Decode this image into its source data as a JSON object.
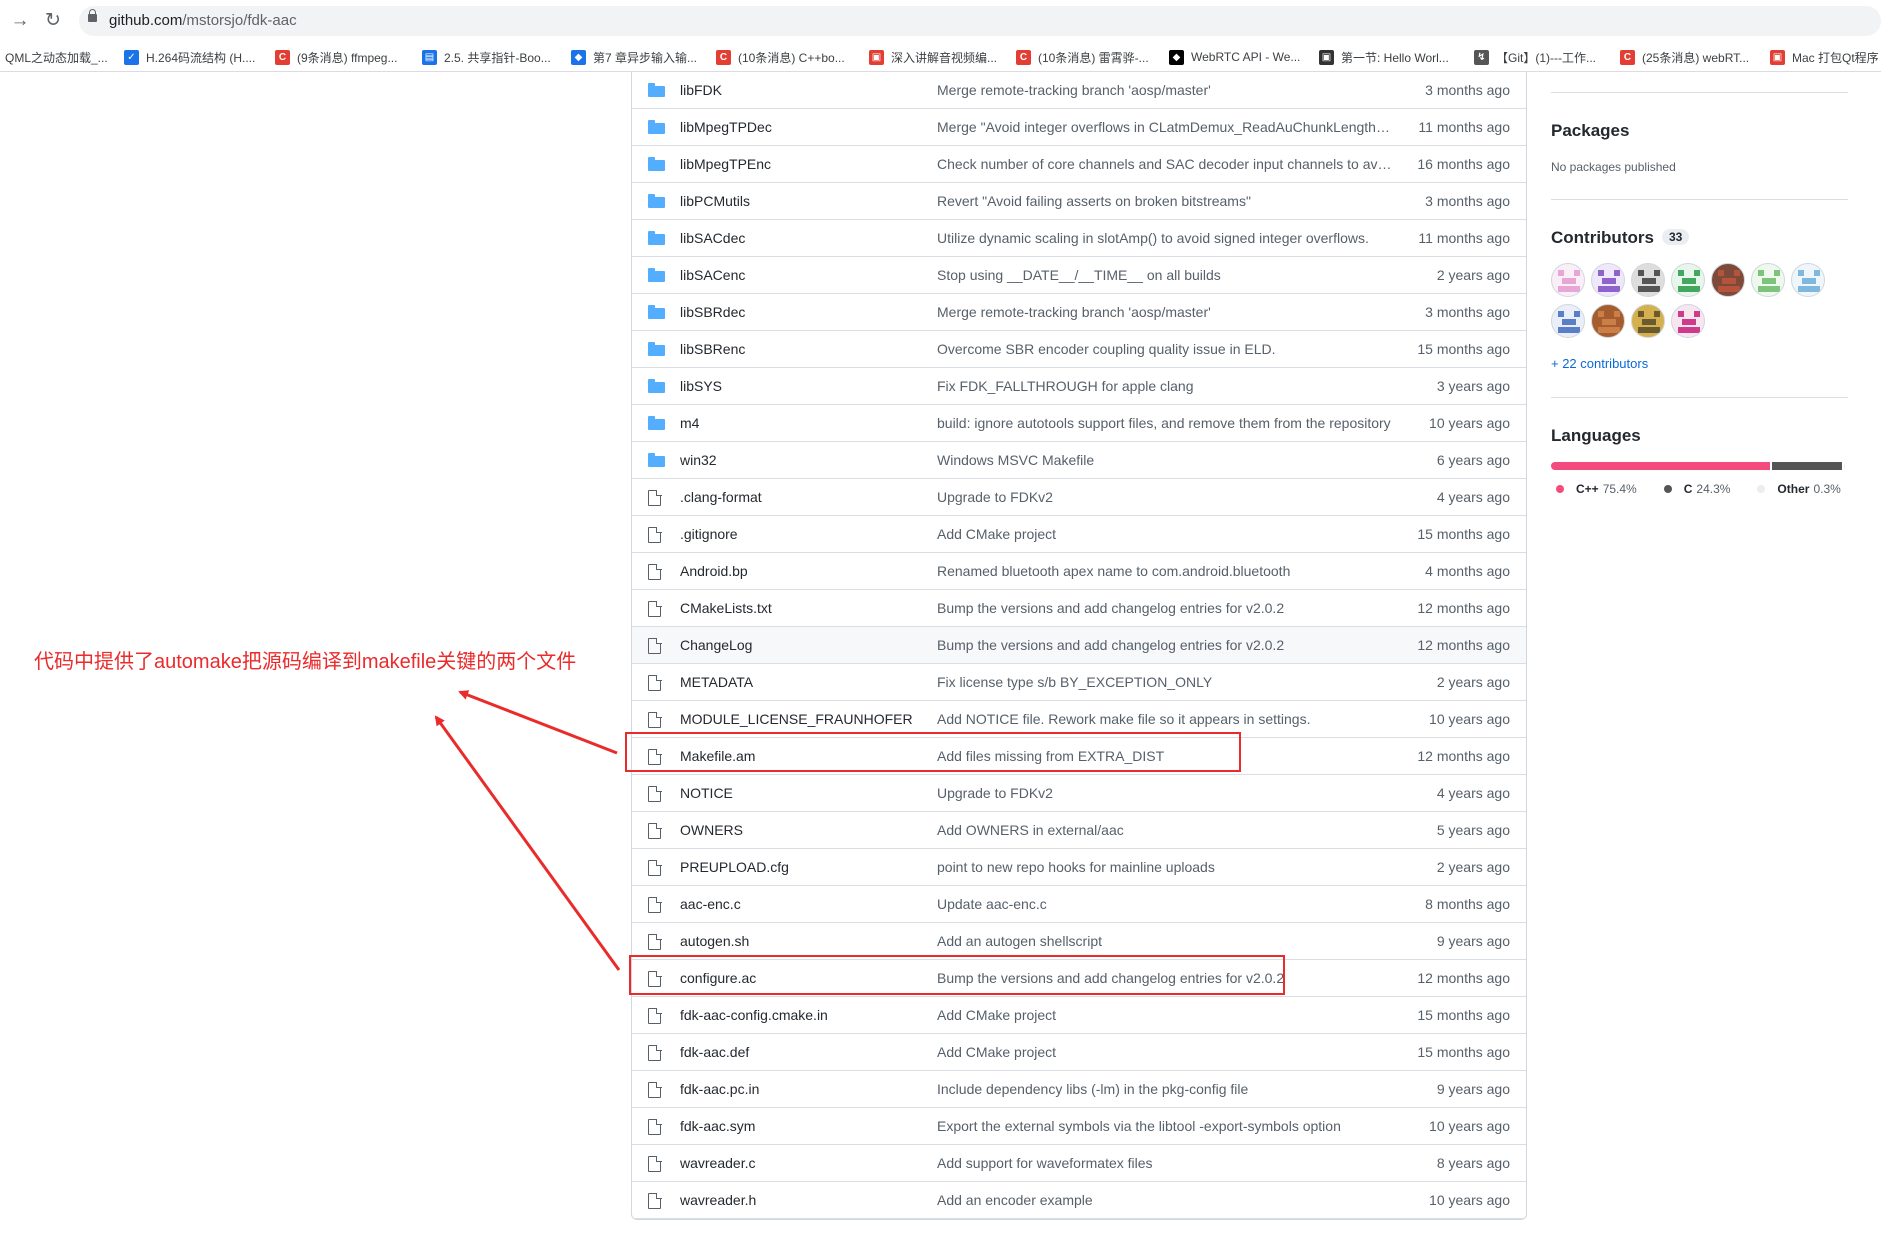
{
  "browser": {
    "back_icon": "arrow-left-icon",
    "reload_icon": "reload-icon",
    "url_host": "github.com",
    "url_path": "/mstorsjo/fdk-aac",
    "bookmarks": [
      {
        "label": "QML之动态加载_...",
        "icon": "none",
        "color": ""
      },
      {
        "label": "H.264码流结构 (H....",
        "icon": "chevron-icon",
        "color": "#1a73e8"
      },
      {
        "label": "(9条消息) ffmpeg...",
        "icon": "csdn-icon",
        "color": "#e33e33"
      },
      {
        "label": "2.5. 共享指针-Boo...",
        "icon": "doc-icon",
        "color": "#1a73e8"
      },
      {
        "label": "第7 章异步输入输...",
        "icon": "layers-icon",
        "color": "#1a73e8"
      },
      {
        "label": "(10条消息) C++bo...",
        "icon": "csdn-icon",
        "color": "#e33e33"
      },
      {
        "label": "深入讲解音视频编...",
        "icon": "square-icon",
        "color": "#e33e33"
      },
      {
        "label": "(10条消息) 雷霄骅-...",
        "icon": "csdn-icon",
        "color": "#e33e33"
      },
      {
        "label": "WebRTC API - We...",
        "icon": "mdn-icon",
        "color": "#000000"
      },
      {
        "label": "第一节: Hello Worl...",
        "icon": "square-icon",
        "color": "#333333"
      },
      {
        "label": "【Git】(1)---工作...",
        "icon": "feather-icon",
        "color": "#555555"
      },
      {
        "label": "(25条消息) webRT...",
        "icon": "csdn-icon",
        "color": "#e33e33"
      },
      {
        "label": "Mac 打包Qt程序",
        "icon": "square-icon",
        "color": "#e33e33"
      }
    ]
  },
  "files": [
    {
      "name": "libFDK",
      "type": "dir",
      "message": "Merge remote-tracking branch 'aosp/master'",
      "age": "3 months ago"
    },
    {
      "name": "libMpegTPDec",
      "type": "dir",
      "message": "Merge \"Avoid integer overflows in CLatmDemux_ReadAuChunkLengthInfo\"",
      "age": "11 months ago"
    },
    {
      "name": "libMpegTPEnc",
      "type": "dir",
      "message": "Check number of core channels and SAC decoder input channels to avoid",
      "age": "16 months ago"
    },
    {
      "name": "libPCMutils",
      "type": "dir",
      "message": "Revert \"Avoid failing asserts on broken bitstreams\"",
      "age": "3 months ago"
    },
    {
      "name": "libSACdec",
      "type": "dir",
      "message": "Utilize dynamic scaling in slotAmp() to avoid signed integer overflows.",
      "age": "11 months ago"
    },
    {
      "name": "libSACenc",
      "type": "dir",
      "message": "Stop using __DATE__/__TIME__ on all builds",
      "age": "2 years ago"
    },
    {
      "name": "libSBRdec",
      "type": "dir",
      "message": "Merge remote-tracking branch 'aosp/master'",
      "age": "3 months ago"
    },
    {
      "name": "libSBRenc",
      "type": "dir",
      "message": "Overcome SBR encoder coupling quality issue in ELD.",
      "age": "15 months ago"
    },
    {
      "name": "libSYS",
      "type": "dir",
      "message": "Fix FDK_FALLTHROUGH for apple clang",
      "age": "3 years ago"
    },
    {
      "name": "m4",
      "type": "dir",
      "message": "build: ignore autotools support files, and remove them from the repository",
      "age": "10 years ago"
    },
    {
      "name": "win32",
      "type": "dir",
      "message": "Windows MSVC Makefile",
      "age": "6 years ago"
    },
    {
      "name": ".clang-format",
      "type": "file",
      "message": "Upgrade to FDKv2",
      "age": "4 years ago"
    },
    {
      "name": ".gitignore",
      "type": "file",
      "message": "Add CMake project",
      "age": "15 months ago"
    },
    {
      "name": "Android.bp",
      "type": "file",
      "message": "Renamed bluetooth apex name to com.android.bluetooth",
      "age": "4 months ago"
    },
    {
      "name": "CMakeLists.txt",
      "type": "file",
      "message": "Bump the versions and add changelog entries for v2.0.2",
      "age": "12 months ago"
    },
    {
      "name": "ChangeLog",
      "type": "file",
      "message": "Bump the versions and add changelog entries for v2.0.2",
      "age": "12 months ago"
    },
    {
      "name": "METADATA",
      "type": "file",
      "message": "Fix license type s/b BY_EXCEPTION_ONLY",
      "age": "2 years ago"
    },
    {
      "name": "MODULE_LICENSE_FRAUNHOFER",
      "type": "file",
      "message": "Add NOTICE file. Rework make file so it appears in settings.",
      "age": "10 years ago"
    },
    {
      "name": "Makefile.am",
      "type": "file",
      "message": "Add files missing from EXTRA_DIST",
      "age": "12 months ago"
    },
    {
      "name": "NOTICE",
      "type": "file",
      "message": "Upgrade to FDKv2",
      "age": "4 years ago"
    },
    {
      "name": "OWNERS",
      "type": "file",
      "message": "Add OWNERS in external/aac",
      "age": "5 years ago"
    },
    {
      "name": "PREUPLOAD.cfg",
      "type": "file",
      "message": "point to new repo hooks for mainline uploads",
      "age": "2 years ago"
    },
    {
      "name": "aac-enc.c",
      "type": "file",
      "message": "Update aac-enc.c",
      "age": "8 months ago"
    },
    {
      "name": "autogen.sh",
      "type": "file",
      "message": "Add an autogen shellscript",
      "age": "9 years ago"
    },
    {
      "name": "configure.ac",
      "type": "file",
      "message": "Bump the versions and add changelog entries for v2.0.2",
      "age": "12 months ago"
    },
    {
      "name": "fdk-aac-config.cmake.in",
      "type": "file",
      "message": "Add CMake project",
      "age": "15 months ago"
    },
    {
      "name": "fdk-aac.def",
      "type": "file",
      "message": "Add CMake project",
      "age": "15 months ago"
    },
    {
      "name": "fdk-aac.pc.in",
      "type": "file",
      "message": "Include dependency libs (-lm) in the pkg-config file",
      "age": "9 years ago"
    },
    {
      "name": "fdk-aac.sym",
      "type": "file",
      "message": "Export the external symbols via the libtool -export-symbols option",
      "age": "10 years ago"
    },
    {
      "name": "wavreader.c",
      "type": "file",
      "message": "Add support for waveformatex files",
      "age": "8 years ago"
    },
    {
      "name": "wavreader.h",
      "type": "file",
      "message": "Add an encoder example",
      "age": "10 years ago"
    }
  ],
  "sidebar": {
    "packages_title": "Packages",
    "packages_empty": "No packages published",
    "contributors_title": "Contributors",
    "contributors_count": "33",
    "contributors_more": "+ 22 contributors",
    "avatars": [
      {
        "fg": "#e6a6d6",
        "bg": "#faeef7"
      },
      {
        "fg": "#8e63cc",
        "bg": "#efe7fa"
      },
      {
        "fg": "#555555",
        "bg": "#dddddd"
      },
      {
        "fg": "#42a85f",
        "bg": "#e7f5eb"
      },
      {
        "fg": "#b5533c",
        "bg": "#7d4a3a"
      },
      {
        "fg": "#7cc47a",
        "bg": "#eef8ee"
      },
      {
        "fg": "#7fb8dc",
        "bg": "#eef6fb"
      },
      {
        "fg": "#5b7fc7",
        "bg": "#e9eef9"
      },
      {
        "fg": "#c97f45",
        "bg": "#a55d30"
      },
      {
        "fg": "#6b5a2e",
        "bg": "#d4b04f"
      },
      {
        "fg": "#cc3c8a",
        "bg": "#f7e6ef"
      }
    ],
    "languages_title": "Languages",
    "languages": [
      {
        "name": "C++",
        "percent": "75.4%",
        "value": 75.4,
        "color": "#f34b7d"
      },
      {
        "name": "C",
        "percent": "24.3%",
        "value": 24.3,
        "color": "#555555"
      },
      {
        "name": "Other",
        "percent": "0.3%",
        "value": 0.3,
        "color": "#ededed"
      }
    ]
  },
  "annotation": {
    "text": "代码中提供了automake把源码编译到makefile关键的两个文件",
    "color": "#ea2b2b",
    "highlighted_files": [
      "Makefile.am",
      "configure.ac"
    ]
  }
}
